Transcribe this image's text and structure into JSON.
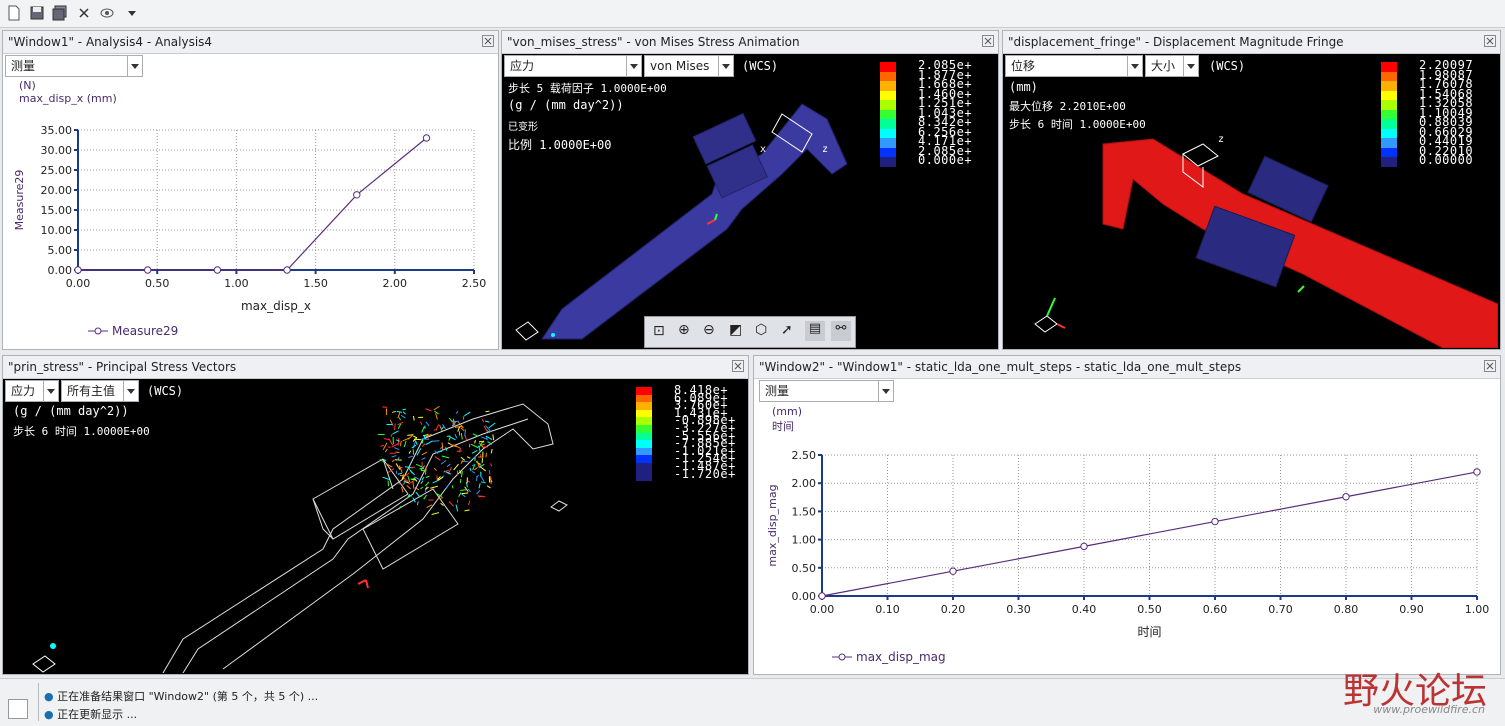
{
  "toolbar": {
    "icons": [
      "new-file-icon",
      "save-icon",
      "save-all-icon",
      "close-icon",
      "eye-icon",
      "dropdown-arrow-icon"
    ]
  },
  "panels": {
    "p1": {
      "title": "\"Window1\" - Analysis4 - Analysis4",
      "dropdown": "测量",
      "unit": "(N)",
      "subtitle": "max_disp_x (mm)",
      "ylabel": "Measure29",
      "xlabel": "max_disp_x",
      "legend": "Measure29",
      "yticks": [
        "35.00",
        "30.00",
        "25.00",
        "20.00",
        "15.00",
        "10.00",
        "5.00",
        "0.00"
      ],
      "xticks": [
        "0.00",
        "0.50",
        "1.00",
        "1.50",
        "2.00",
        "2.50"
      ]
    },
    "p2": {
      "title": "\"von_mises_stress\" - von Mises Stress Animation",
      "dropdown1": "应力",
      "dropdown2": "von Mises",
      "wcs": "(WCS)",
      "line1": "步长  5  载荷因子   1.0000E+00",
      "line2": "(g / (mm day^2))",
      "line3": "已变形",
      "line4": "比例   1.0000E+00",
      "legend_values": [
        "2.085e+",
        "1.877e+",
        "1.668e+",
        "1.460e+",
        "1.251e+",
        "1.043e+",
        "8.342e+",
        "6.256e+",
        "4.171e+",
        "2.085e+",
        "0.000e+"
      ],
      "legend_colors": [
        "#ff0000",
        "#ff6600",
        "#ffb000",
        "#ffff00",
        "#aaff00",
        "#33ff33",
        "#00ff99",
        "#00ffff",
        "#3399ff",
        "#0033ff",
        "#202080"
      ]
    },
    "p3": {
      "title": "\"displacement_fringe\" - Displacement Magnitude Fringe",
      "dropdown1": "位移",
      "dropdown2": "大小",
      "wcs": "(WCS)",
      "line1": "(mm)",
      "line2": "最大位移    2.2010E+00",
      "line3": "步长  6  时间    1.0000E+00",
      "legend_values": [
        "2.20097",
        "1.98087",
        "1.76078",
        "1.54068",
        "1.32058",
        "1.10049",
        "0.88039",
        "0.66029",
        "0.44019",
        "0.22010",
        "0.00000"
      ],
      "legend_colors": [
        "#ff0000",
        "#ff6600",
        "#ffb000",
        "#ffff00",
        "#aaff00",
        "#33ff33",
        "#00ff99",
        "#00ffff",
        "#3399ff",
        "#0033ff",
        "#202080"
      ]
    },
    "p4": {
      "title": "\"prin_stress\" - Principal Stress Vectors",
      "dropdown1": "应力",
      "dropdown2": "所有主值",
      "wcs": "(WCS)",
      "line1": "(g / (mm day^2))",
      "line2": "步长  6  时间    1.0000E+00",
      "legend_values": [
        "8.418e+",
        "6.089e+",
        "3.760e+",
        "1.431e+",
        "-0.898e+",
        "-3.227e+",
        "-5.556e+",
        "-7.885e+",
        "-1.021e+",
        "-1.254e+",
        "-1.487e+",
        "-1.720e+"
      ],
      "legend_colors": [
        "#ff0000",
        "#ff6600",
        "#ffb000",
        "#ffff00",
        "#aaff00",
        "#33ff33",
        "#00ff99",
        "#00ffff",
        "#3399ff",
        "#0033ff",
        "#202080",
        "#202080"
      ]
    },
    "p5": {
      "title": "\"Window2\" - \"Window1\" - static_lda_one_mult_steps - static_lda_one_mult_steps",
      "dropdown": "测量",
      "unit": "(mm)",
      "subtitle": "时间",
      "ylabel": "max_disp_mag",
      "xlabel": "时间",
      "legend": "max_disp_mag",
      "yticks": [
        "2.50",
        "2.00",
        "1.50",
        "1.00",
        "0.50",
        "0.00"
      ],
      "xticks": [
        "0.00",
        "0.10",
        "0.20",
        "0.30",
        "0.40",
        "0.50",
        "0.60",
        "0.70",
        "0.80",
        "0.90",
        "1.00"
      ]
    }
  },
  "chart_data": [
    {
      "type": "line",
      "x": [
        0.0,
        0.44,
        0.88,
        1.32,
        1.76,
        2.2
      ],
      "values": [
        0.0,
        0.0,
        0.0,
        0.0,
        18.8,
        33.0
      ],
      "ylim": [
        0,
        35
      ],
      "xlim": [
        0,
        2.5
      ],
      "ylabel": "Measure29",
      "xlabel": "max_disp_x",
      "series_name": "Measure29",
      "color": "#5a2d7a"
    },
    {
      "type": "line",
      "x": [
        0.0,
        0.2,
        0.4,
        0.6,
        0.8,
        1.0
      ],
      "values": [
        0.0,
        0.44,
        0.88,
        1.32,
        1.76,
        2.2
      ],
      "ylim": [
        0,
        2.5
      ],
      "xlim": [
        0,
        1.0
      ],
      "ylabel": "max_disp_mag",
      "xlabel": "时间",
      "series_name": "max_disp_mag",
      "color": "#5a2d7a"
    }
  ],
  "status": {
    "line1": "正在准备结果窗口 \"Window2\" (第 5 个，共 5 个) ...",
    "line2": "正在更新显示 ..."
  },
  "watermark": {
    "text": "野火论坛",
    "url": "www.proewildfire.cn"
  }
}
